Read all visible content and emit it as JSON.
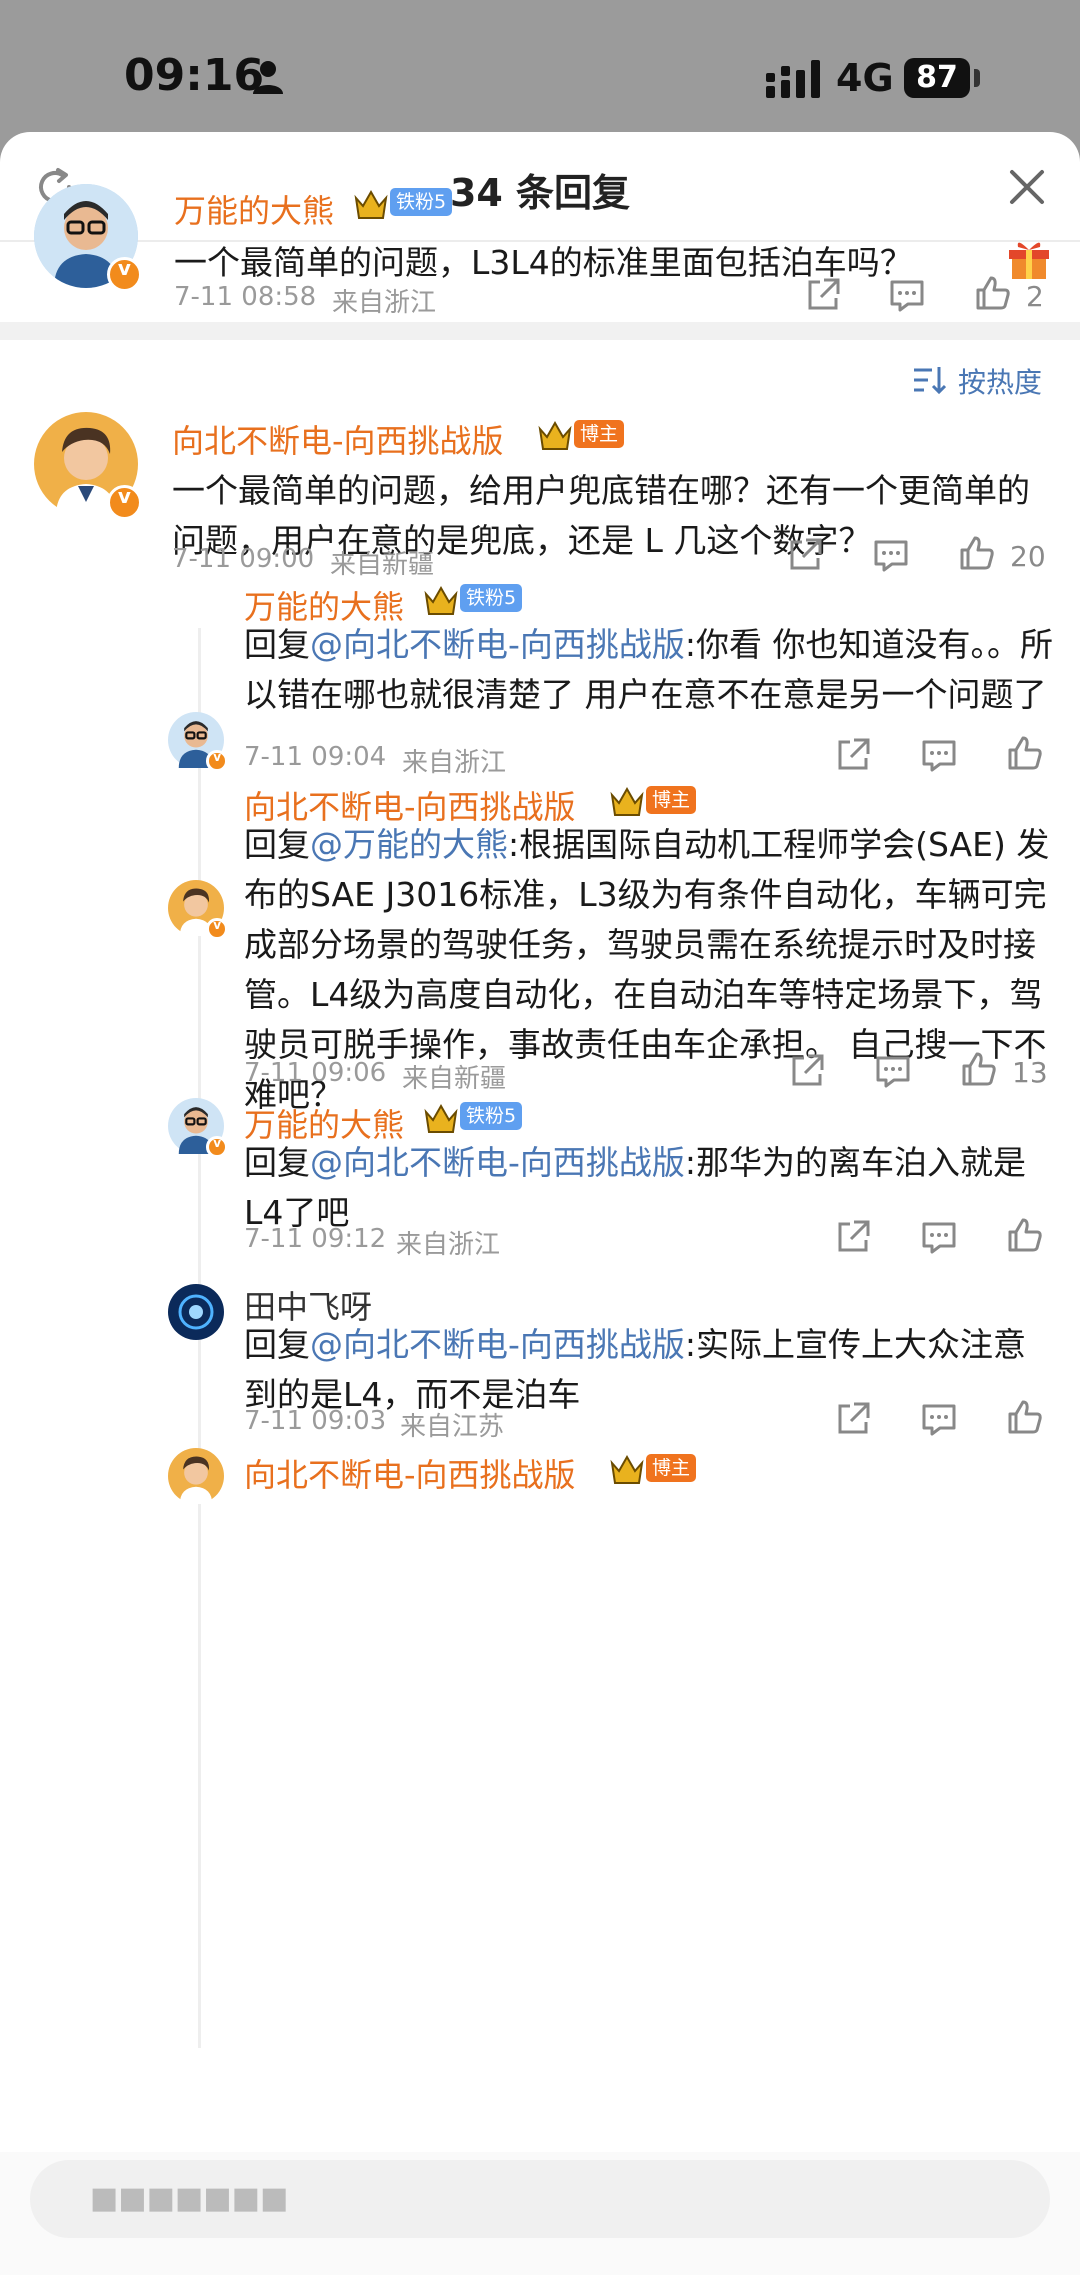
{
  "status_bar": {
    "time": "09:16",
    "network": "4G",
    "battery": "87"
  },
  "header": {
    "title": "34 条回复"
  },
  "root_comment": {
    "user": "万能的大熊",
    "fan_badge": "铁粉5",
    "text": "一个最简单的问题，L3L4的标准里面包括泊车吗？",
    "time": "7-11 08:58",
    "location": "来自浙江",
    "likes": "2"
  },
  "sort": {
    "label": "按热度"
  },
  "comments": [
    {
      "user": "向北不断电-向西挑战版",
      "badge": "博主",
      "text": "一个最简单的问题，给用户兜底错在哪？还有一个更简单的问题，用户在意的是兜底，还是 L 几这个数字？",
      "time": "7-11 09:00",
      "location": "来自新疆",
      "likes": "20"
    }
  ],
  "replies": [
    {
      "user": "万能的大熊",
      "badge": "铁粉5",
      "reply_prefix": "回复",
      "mention": "@向北不断电-向西挑战版",
      "text": ":你看 你也知道没有。。所以错在哪也就很清楚了 用户在意不在意是另一个问题了",
      "time": "7-11 09:04",
      "location": "来自浙江",
      "likes": ""
    },
    {
      "user": "向北不断电-向西挑战版",
      "badge": "博主",
      "reply_prefix": "回复",
      "mention": "@万能的大熊",
      "text": ":根据国际自动机工程师学会(SAE) 发布的SAE J3016标准，L3级为有条件自动化，车辆可完成部分场景的驾驶任务，驾驶员需在系统提示时及时接管。L4级为高度自动化，在自动泊车等特定场景下，驾驶员可脱手操作，事故责任由车企承担。 自己搜一下不难吧？",
      "time": "7-11 09:06",
      "location": "来自新疆",
      "likes": "13"
    },
    {
      "user": "万能的大熊",
      "badge": "铁粉5",
      "reply_prefix": "回复",
      "mention": "@向北不断电-向西挑战版",
      "text": ":那华为的离车泊入就是L4了吧",
      "time": "7-11 09:12",
      "location": "来自浙江",
      "likes": ""
    },
    {
      "user": "田中飞呀",
      "badge": "",
      "reply_prefix": "回复",
      "mention": "@向北不断电-向西挑战版",
      "text": ":实际上宣传上大众注意到的是L4，而不是泊车",
      "time": "7-11 09:03",
      "location": "来自江苏",
      "likes": ""
    },
    {
      "user": "向北不断电-向西挑战版",
      "badge": "博主"
    }
  ],
  "input": {
    "placeholder": "■■■■■■■"
  }
}
